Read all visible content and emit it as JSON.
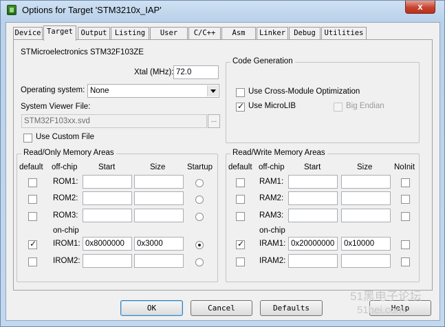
{
  "window": {
    "title": "Options for Target 'STM3210x_IAP'",
    "close": "x"
  },
  "tabs": [
    {
      "label": "Device"
    },
    {
      "label": "Target"
    },
    {
      "label": "Output"
    },
    {
      "label": "Listing"
    },
    {
      "label": "User"
    },
    {
      "label": "C/C++"
    },
    {
      "label": "Asm"
    },
    {
      "label": "Linker"
    },
    {
      "label": "Debug"
    },
    {
      "label": "Utilities"
    }
  ],
  "active_tab": "Target",
  "target": {
    "device_name": "STMicroelectronics STM32F103ZE",
    "xtal_label": "Xtal (MHz):",
    "xtal_value": "72.0",
    "os_label": "Operating system:",
    "os_value": "None",
    "svf_label": "System Viewer File:",
    "svf_value": "STM32F103xx.svd",
    "browse_label": "...",
    "custom_file_label": "Use Custom File",
    "custom_file_checked": false
  },
  "code_generation": {
    "title": "Code Generation",
    "cross_module_label": "Use Cross-Module Optimization",
    "cross_module_checked": false,
    "microlib_label": "Use MicroLIB",
    "microlib_checked": true,
    "big_endian_label": "Big Endian",
    "big_endian_checked": false
  },
  "ro_memory": {
    "title": "Read/Only Memory Areas",
    "headers": {
      "default": "default",
      "offchip": "off-chip",
      "start": "Start",
      "size": "Size",
      "startup": "Startup"
    },
    "onchip_label": "on-chip",
    "rows": [
      {
        "name": "ROM1:",
        "default": false,
        "start": "",
        "size": "",
        "startup": false
      },
      {
        "name": "ROM2:",
        "default": false,
        "start": "",
        "size": "",
        "startup": false
      },
      {
        "name": "ROM3:",
        "default": false,
        "start": "",
        "size": "",
        "startup": false
      },
      {
        "name": "IROM1:",
        "default": true,
        "start": "0x8000000",
        "size": "0x3000",
        "startup": true
      },
      {
        "name": "IROM2:",
        "default": false,
        "start": "",
        "size": "",
        "startup": false
      }
    ]
  },
  "rw_memory": {
    "title": "Read/Write Memory Areas",
    "headers": {
      "default": "default",
      "offchip": "off-chip",
      "start": "Start",
      "size": "Size",
      "noinit": "NoInit"
    },
    "onchip_label": "on-chip",
    "rows": [
      {
        "name": "RAM1:",
        "default": false,
        "start": "",
        "size": "",
        "noinit": false
      },
      {
        "name": "RAM2:",
        "default": false,
        "start": "",
        "size": "",
        "noinit": false
      },
      {
        "name": "RAM3:",
        "default": false,
        "start": "",
        "size": "",
        "noinit": false
      },
      {
        "name": "IRAM1:",
        "default": true,
        "start": "0x20000000",
        "size": "0x10000",
        "noinit": false
      },
      {
        "name": "IRAM2:",
        "default": false,
        "start": "",
        "size": "",
        "noinit": false
      }
    ]
  },
  "buttons": {
    "ok": "OK",
    "cancel": "Cancel",
    "defaults": "Defaults",
    "help": "Help"
  },
  "watermark": {
    "line1": "51黑电子论坛",
    "line2": "51hei.com"
  }
}
